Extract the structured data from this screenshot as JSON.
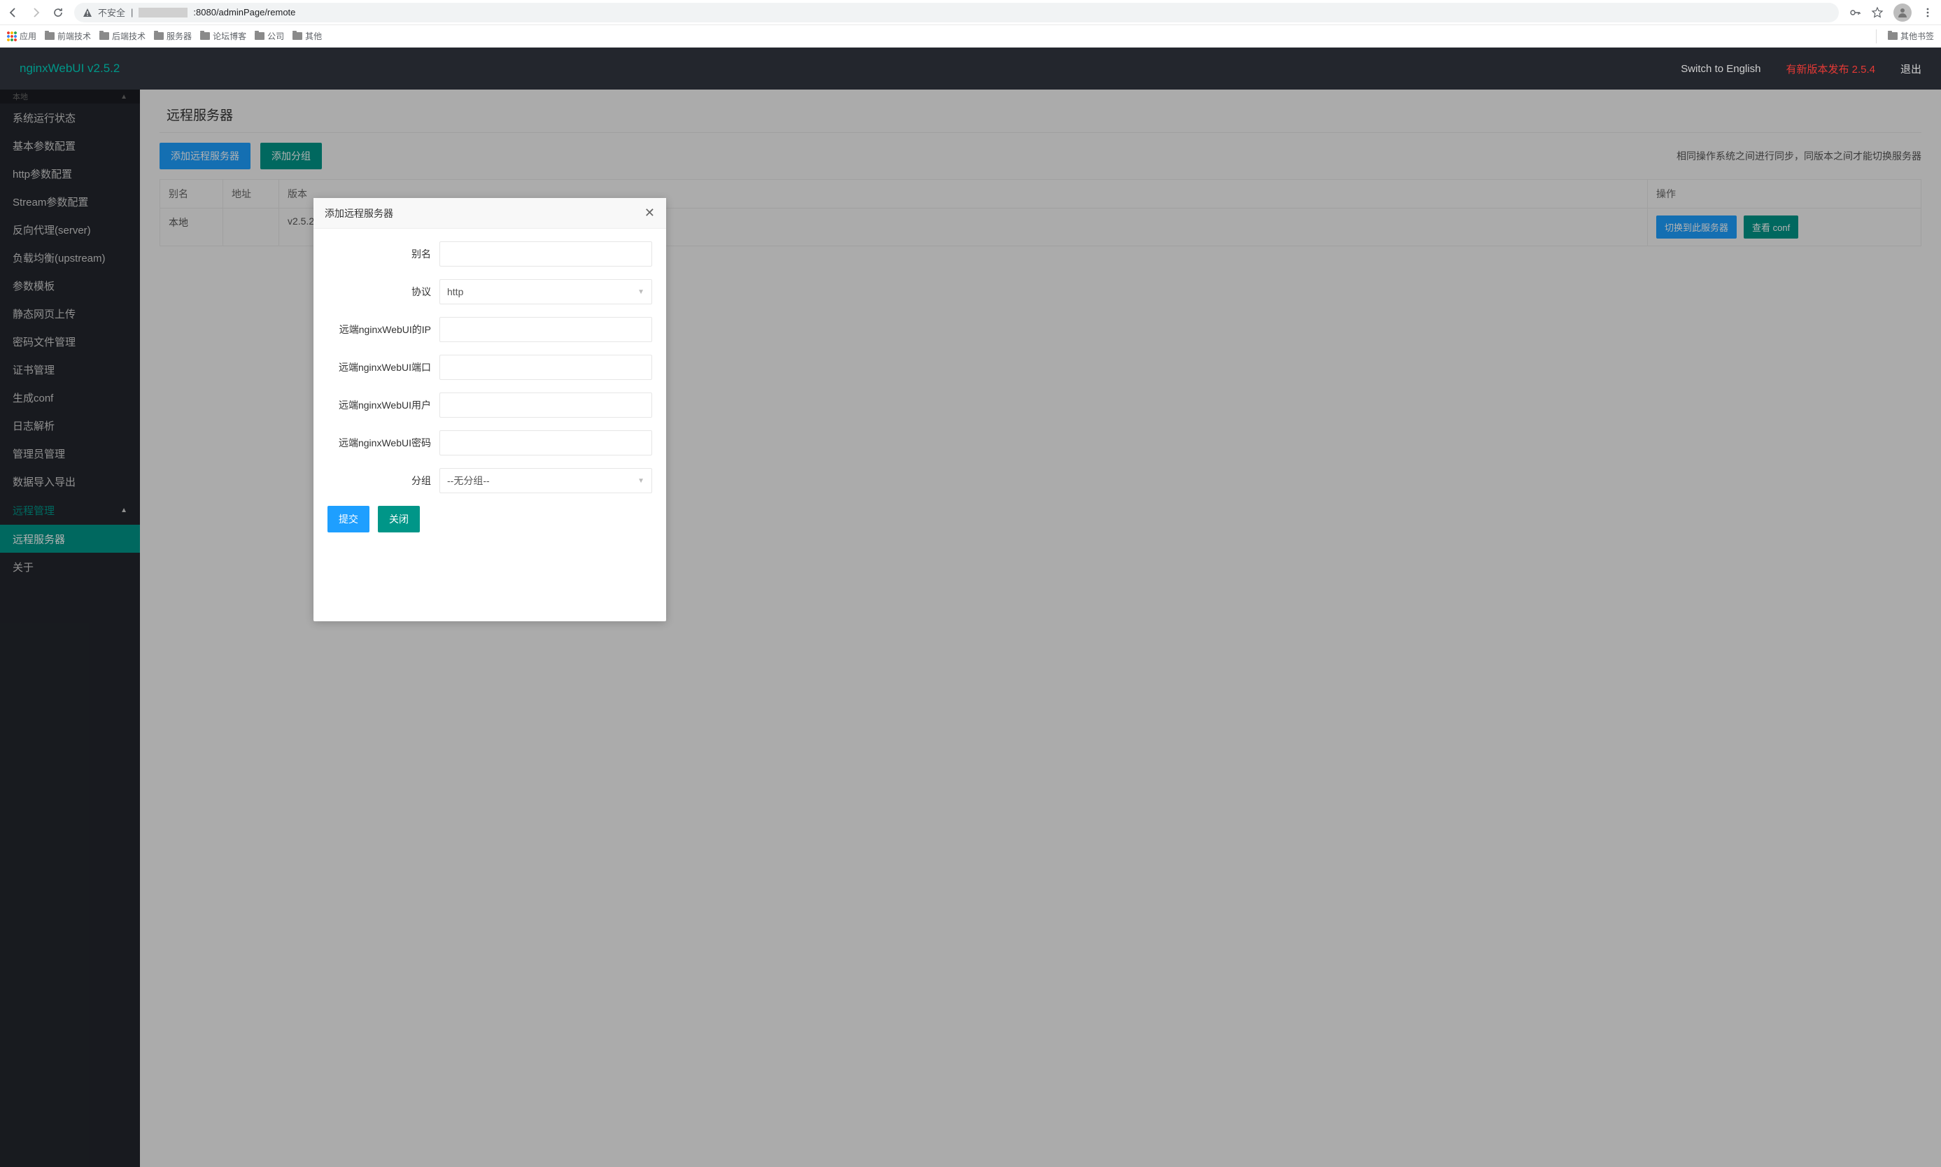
{
  "browser": {
    "insecure": "不安全",
    "url_suffix": ":8080/adminPage/remote",
    "other_bookmarks": "其他书签"
  },
  "bookmarks": {
    "apps": "应用",
    "items": [
      "前端技术",
      "后端技术",
      "服务器",
      "论坛博客",
      "公司",
      "其他"
    ]
  },
  "header": {
    "title": "nginxWebUI v2.5.2",
    "switch": "Switch to English",
    "new_version": "有新版本发布 2.5.4",
    "logout": "退出"
  },
  "sidebar": {
    "group_top": "本地",
    "items": [
      "系统运行状态",
      "基本参数配置",
      "http参数配置",
      "Stream参数配置",
      "反向代理(server)",
      "负载均衡(upstream)",
      "参数模板",
      "静态网页上传",
      "密码文件管理",
      "证书管理",
      "生成conf",
      "日志解析",
      "管理员管理",
      "数据导入导出"
    ],
    "group_remote": "远程管理",
    "remote_items": [
      "远程服务器"
    ],
    "about": "关于"
  },
  "page": {
    "title": "远程服务器",
    "add_server": "添加远程服务器",
    "add_group": "添加分组",
    "note": "相同操作系统之间进行同步，同版本之间才能切换服务器"
  },
  "table": {
    "headers": {
      "alias": "别名",
      "addr": "地址",
      "version": "版本",
      "ops": "操作"
    },
    "rows": [
      {
        "alias": "本地",
        "addr": "",
        "version": "v2.5.2",
        "switch": "切换到此服务器",
        "view": "查看 conf"
      }
    ]
  },
  "modal": {
    "title": "添加远程服务器",
    "labels": {
      "alias": "别名",
      "protocol": "协议",
      "ip": "远端nginxWebUI的IP",
      "port": "远端nginxWebUI端口",
      "user": "远端nginxWebUI用户",
      "pass": "远端nginxWebUI密码",
      "group": "分组"
    },
    "protocol_value": "http",
    "group_value": "--无分组--",
    "submit": "提交",
    "close": "关闭"
  }
}
